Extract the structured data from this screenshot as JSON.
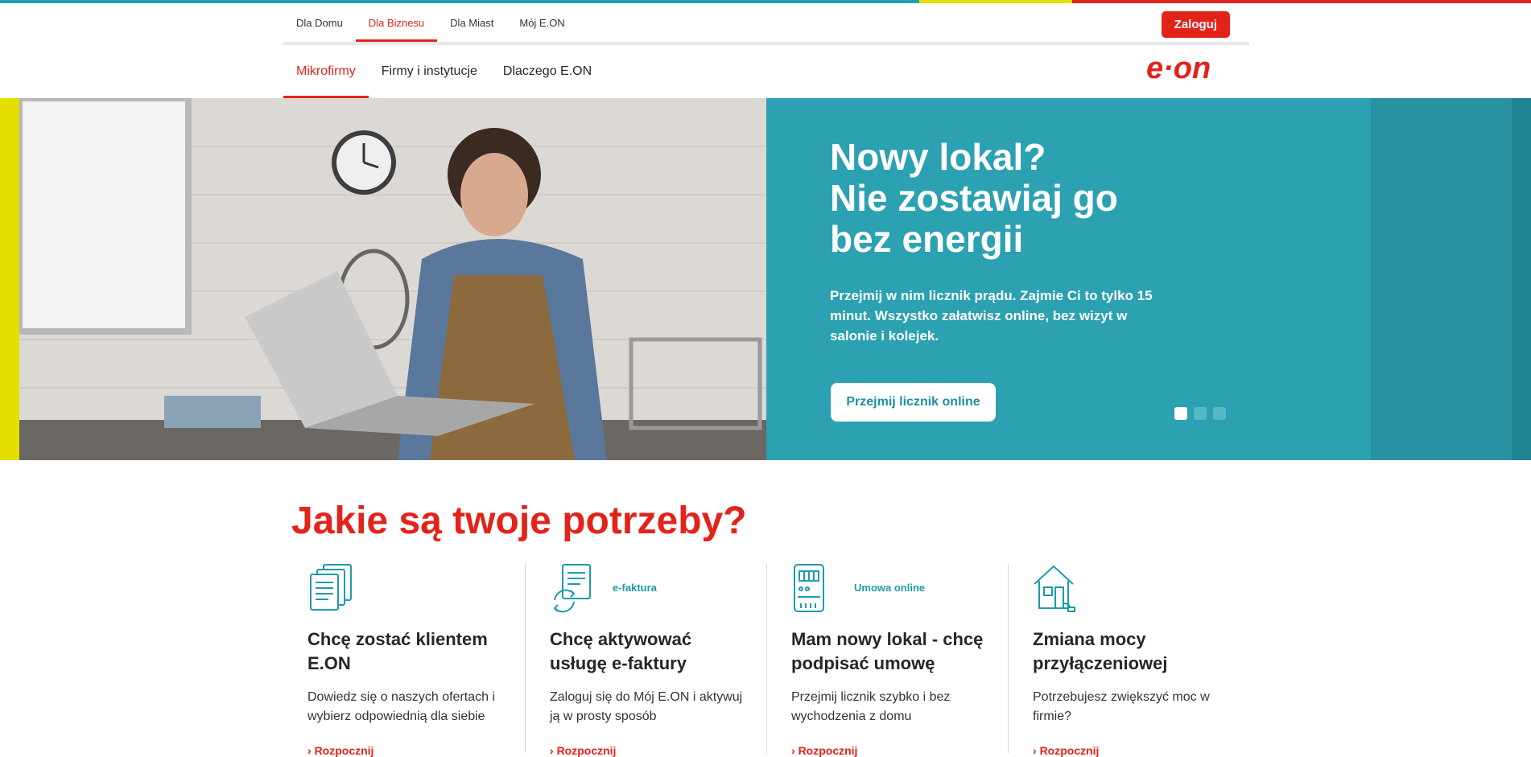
{
  "colors": {
    "brand_red": "#e2231a",
    "hero_teal": "#2ba1b2",
    "accent_yellow": "#e3e000"
  },
  "top_nav": {
    "links": [
      "Dla Domu",
      "Dla Biznesu",
      "Dla Miast",
      "Mój E.ON"
    ],
    "active": "Dla Biznesu",
    "login_label": "Zaloguj"
  },
  "main_nav": {
    "links": [
      "Mikrofirmy",
      "Firmy i instytucje",
      "Dlaczego E.ON"
    ],
    "active": "Mikrofirmy",
    "logo_text": "e·on"
  },
  "hero": {
    "title_lines": [
      "Nowy lokal?",
      "Nie zostawiaj go",
      "bez energii"
    ],
    "text": "Przejmij w nim licznik prądu. Zajmie Ci to tylko 15 minut. Wszystko załatwisz online, bez wizyt w salonie i kolejek.",
    "button_label": "Przejmij licznik online",
    "slides_total": 3,
    "active_slide": 1
  },
  "needs": {
    "title": "Jakie są twoje potrzeby?",
    "cards": [
      {
        "icon": "documents-icon",
        "tag": "",
        "title": "Chcę zostać klientem E.ON",
        "description": "Dowiedz się o naszych ofertach i wybierz odpowiednią dla siebie",
        "link": "Rozpocznij"
      },
      {
        "icon": "e-invoice-icon",
        "tag": "e-faktura",
        "title": "Chcę aktywować usługę e-faktury",
        "description": "Zaloguj się do Mój E.ON i aktywuj ją w prosty sposób",
        "link": "Rozpocznij"
      },
      {
        "icon": "electric-meter-icon",
        "tag": "Umowa online",
        "title": "Mam nowy lokal - chcę podpisać umowę",
        "description": "Przejmij licznik szybko i bez wychodzenia z domu",
        "link": "Rozpocznij"
      },
      {
        "icon": "house-plug-icon",
        "tag": "",
        "title": "Zmiana mocy przyłączeniowej",
        "description": "Potrzebujesz zwiększyć moc w firmie?",
        "link": "Rozpocznij"
      }
    ]
  }
}
